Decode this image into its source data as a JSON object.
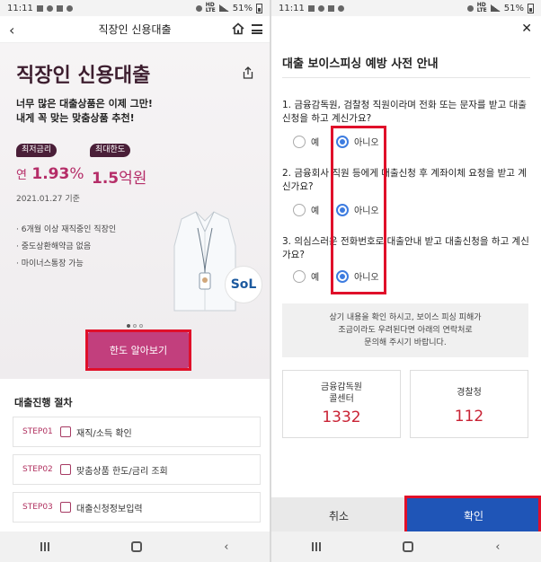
{
  "left": {
    "status": {
      "time": "11:11",
      "battery": "51%"
    },
    "header": {
      "title": "직장인 신용대출"
    },
    "hero": {
      "title": "직장인 신용대출",
      "subtitle_line1": "너무 많은 대출상품은 이제 그만!",
      "subtitle_line2": "내게 꼭 맞는 맞춤상품 추천!",
      "badge_min_rate": "최저금리",
      "badge_max_limit": "최대한도",
      "rate_prefix": "연",
      "rate_value": "1.93",
      "rate_unit": "%",
      "limit_value": "1.5",
      "limit_unit": "억원",
      "date": "2021.01.27 기준",
      "bullets": [
        "6개월 이상 재직중인 직장인",
        "중도상환해약금 없음",
        "마이너스통장 가능"
      ],
      "sol_logo": "SoL",
      "cta": "한도 알아보기"
    },
    "steps": {
      "title": "대출진행 절차",
      "items": [
        {
          "code": "STEP01",
          "label": "재직/소득 확인"
        },
        {
          "code": "STEP02",
          "label": "맞춤상품 한도/금리 조회"
        },
        {
          "code": "STEP03",
          "label": "대출신청정보입력"
        }
      ]
    }
  },
  "right": {
    "status": {
      "time": "11:11",
      "battery": "51%"
    },
    "title": "대출 보이스피싱 예방 사전 안내",
    "questions": [
      {
        "text": "1. 금융감독원, 검찰청 직원이라며 전화 또는 문자를 받고 대출신청을 하고 계신가요?",
        "yes": "예",
        "no": "아니오",
        "selected": "no"
      },
      {
        "text": "2. 금융회사 직원 등에게 대출신청 후 계좌이체 요청을 받고 계신가요?",
        "yes": "예",
        "no": "아니오",
        "selected": "no"
      },
      {
        "text": "3. 의심스러운 전화번호로 대출안내 받고 대출신청을 하고 계신가요?",
        "yes": "예",
        "no": "아니오",
        "selected": "no"
      }
    ],
    "notice": {
      "line1": "상기 내용을 확인 하시고, 보이스 피싱 피해가",
      "line2": "조금이라도 우려된다면 아래의 연락처로",
      "line3": "문의해 주시기 바랍니다."
    },
    "contacts": [
      {
        "name_line1": "금융감독원",
        "name_line2": "콜센터",
        "number": "1332"
      },
      {
        "name_line1": "경찰청",
        "name_line2": "",
        "number": "112"
      }
    ],
    "buttons": {
      "cancel": "취소",
      "confirm": "확인"
    }
  }
}
